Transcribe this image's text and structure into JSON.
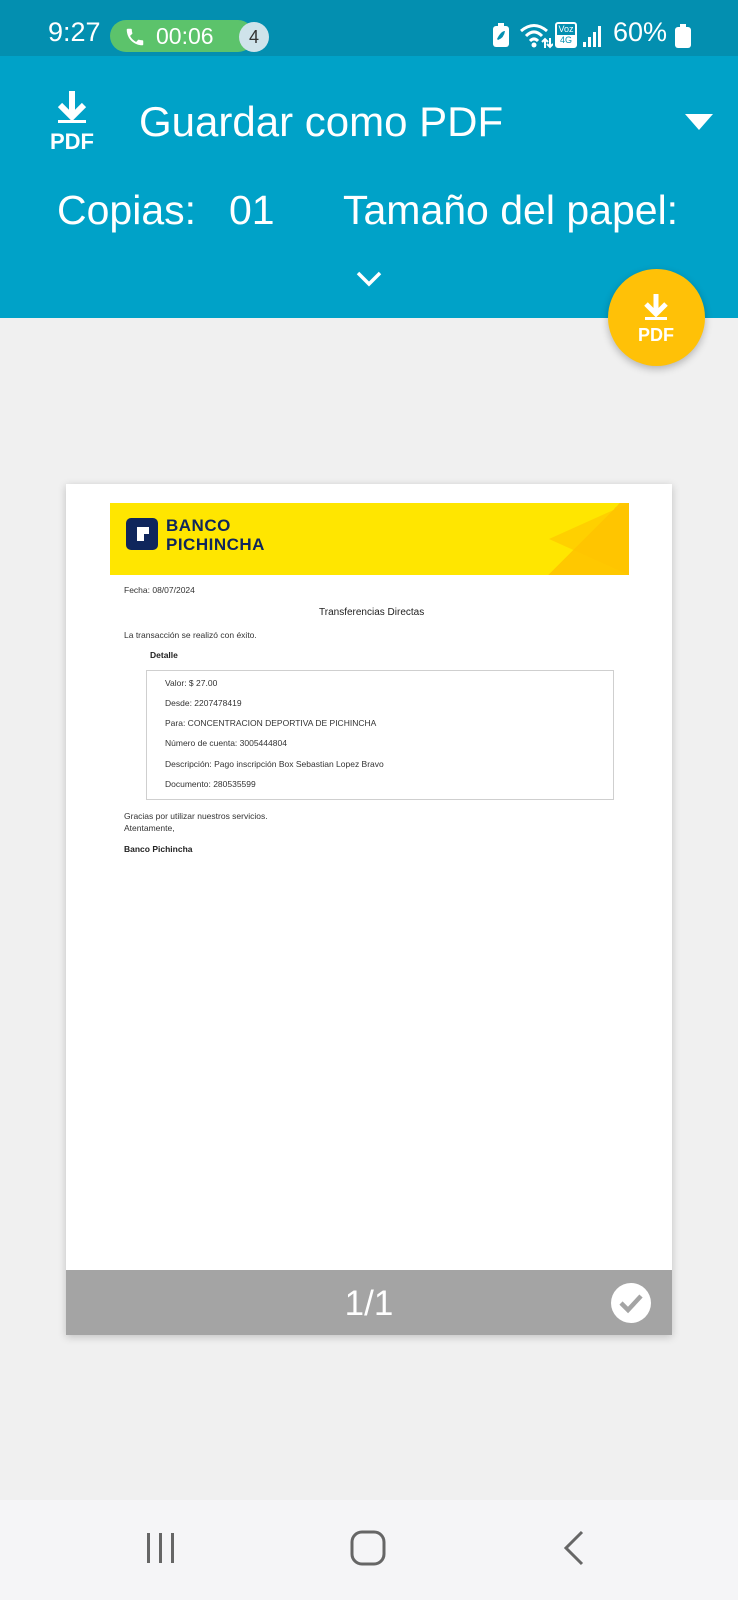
{
  "status_bar": {
    "time": "9:27",
    "call_timer": "00:06",
    "notification_count": "4",
    "battery_percent": "60%",
    "icons": [
      "phone-icon",
      "battery-saver-icon",
      "wifi-icon",
      "volte-icon",
      "signal-icon",
      "battery-icon"
    ]
  },
  "header": {
    "destination_icon_text": "PDF",
    "destination": "Guardar como PDF",
    "copies_label": "Copias:",
    "copies_value": "01",
    "paper_size_label": "Tamaño del papel:",
    "volte_top": "Voz",
    "volte_bottom": "4G"
  },
  "fab": {
    "icon_text": "PDF"
  },
  "document": {
    "bank_name_line1": "BANCO",
    "bank_name_line2": "PICHINCHA",
    "date": "Fecha: 08/07/2024",
    "title": "Transferencias Directas",
    "status_message": "La transacción se realizó con éxito.",
    "detail_heading": "Detalle",
    "details": {
      "value": "Valor: $ 27.00",
      "from": "Desde: 2207478419",
      "to": "Para: CONCENTRACION DEPORTIVA DE PICHINCHA",
      "account": "Número de cuenta: 3005444804",
      "description": "Descripción: Pago inscripción Box Sebastian Lopez Bravo",
      "document": "Documento: 280535599"
    },
    "thanks": "Gracias por utilizar nuestros servicios.",
    "closing": "Atentamente,",
    "signature": "Banco Pichincha"
  },
  "preview": {
    "page_indicator": "1/1",
    "page_selected": true
  },
  "colors": {
    "status_bar": "#038fb0",
    "header": "#00a2c8",
    "fab": "#ffc107",
    "bank_yellow": "#ffe600",
    "bank_navy": "#0f265c"
  }
}
